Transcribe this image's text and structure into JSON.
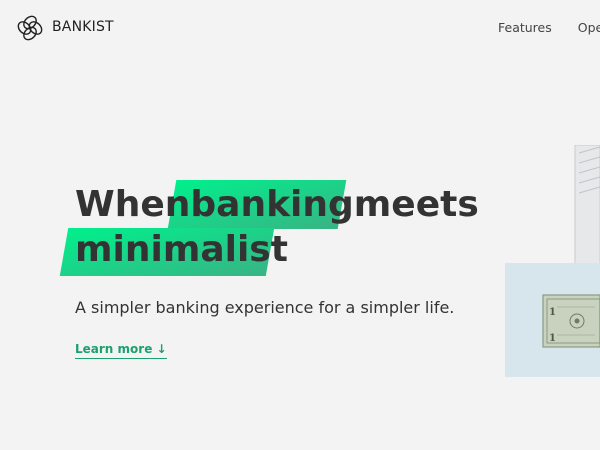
{
  "nav": {
    "brand": "BANKIST",
    "links": [
      {
        "label": "Features"
      },
      {
        "label": "Opera"
      }
    ]
  },
  "hero": {
    "title_line1_a": "When ",
    "title_line1_b": "banking",
    "title_line1_c": " meets",
    "title_line2": "minimalist",
    "subtitle": "A simpler banking experience for a simpler life.",
    "learn_more": "Learn more ↓"
  },
  "colors": {
    "background": "#f3f3f3",
    "accent": "#39b385",
    "accent_light": "#00f08c",
    "text": "#333333"
  },
  "icons": {
    "logo": "bankist-logo-icon",
    "learn_more_arrow": "arrow-down"
  }
}
